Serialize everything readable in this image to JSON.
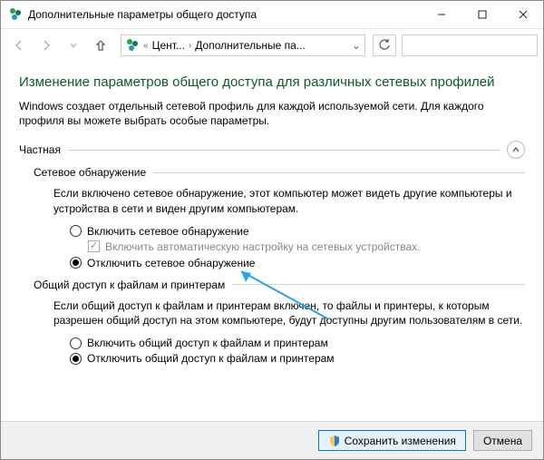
{
  "window": {
    "title": "Дополнительные параметры общего доступа"
  },
  "breadcrumb": {
    "part1": "Цент...",
    "part2": "Дополнительные па..."
  },
  "page": {
    "heading": "Изменение параметров общего доступа для различных сетевых профилей",
    "description": "Windows создает отдельный сетевой профиль для каждой используемой сети. Для каждого профиля вы можете выбрать особые параметры."
  },
  "profile": {
    "label": "Частная"
  },
  "network_discovery": {
    "title": "Сетевое обнаружение",
    "description": "Если включено сетевое обнаружение, этот компьютер может видеть другие компьютеры и устройства в сети и виден другим компьютерам.",
    "option_on": "Включить сетевое обнаружение",
    "checkbox": "Включить автоматическую настройку на сетевых устройствах.",
    "option_off": "Отключить сетевое обнаружение"
  },
  "file_printer": {
    "title": "Общий доступ к файлам и принтерам",
    "description": "Если общий доступ к файлам и принтерам включен, то файлы и принтеры, к которым разрешен общий доступ на этом компьютере, будут доступны другим пользователям в сети.",
    "option_on": "Включить общий доступ к файлам и принтерам",
    "option_off": "Отключить общий доступ к файлам и принтерам"
  },
  "footer": {
    "save": "Сохранить изменения",
    "cancel": "Отмена"
  }
}
